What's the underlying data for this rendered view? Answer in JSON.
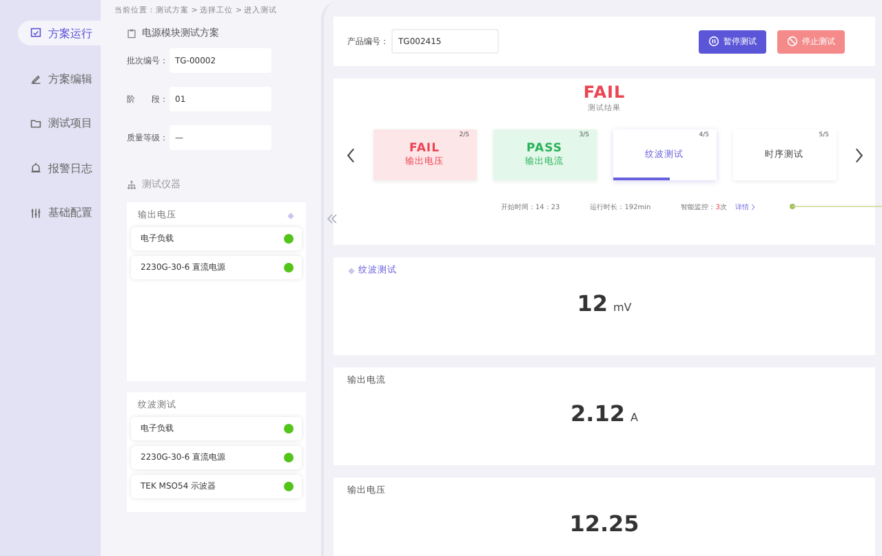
{
  "sidebar": {
    "items": [
      {
        "label": "方案运行",
        "selected": true
      },
      {
        "label": "方案编辑",
        "selected": false
      },
      {
        "label": "测试项目",
        "selected": false
      },
      {
        "label": "报警日志",
        "selected": false
      },
      {
        "label": "基础配置",
        "selected": false
      }
    ]
  },
  "breadcrumb": "当前位置：测试方案 > 选择工位 > 进入测试",
  "plan": {
    "title": "电源模块测试方案",
    "fields": [
      {
        "label": "批次编号：",
        "value": "TG-00002"
      },
      {
        "label": "阶　　段：",
        "value": "01"
      },
      {
        "label": "质量等级：",
        "value": "—"
      }
    ]
  },
  "instruments": {
    "title": "测试仪器",
    "groups": [
      {
        "title": "输出电压",
        "items": [
          {
            "name": "电子负载",
            "color": "#52c41a"
          },
          {
            "name": "2230G-30-6 直流电源",
            "color": "#52c41a"
          }
        ]
      },
      {
        "title": "纹波测试",
        "items": [
          {
            "name": "电子负载",
            "color": "#52c41a"
          },
          {
            "name": "2230G-30-6 直流电源",
            "color": "#52c41a"
          },
          {
            "name": "TEK MSO54 示波器",
            "color": "#52c41a"
          }
        ]
      }
    ]
  },
  "product": {
    "label": "产品编号：",
    "value": "TG002415"
  },
  "buttons": [
    {
      "label": "暂停测试",
      "kind": "pause"
    },
    {
      "label": "停止测试",
      "kind": "stop"
    }
  ],
  "result": {
    "verdict": "FAIL",
    "caption": "测试结果"
  },
  "steps": [
    {
      "index": "2/5",
      "kind": "fail",
      "verdict": "FAIL",
      "name": "输出电压"
    },
    {
      "index": "3/5",
      "kind": "pass",
      "verdict": "PASS",
      "name": "输出电流"
    },
    {
      "index": "4/5",
      "kind": "active",
      "name": "纹波测试",
      "level": 0.55
    },
    {
      "index": "5/5",
      "kind": "pending",
      "name": "时序测试"
    }
  ],
  "status": {
    "start": "开始时间：14：23",
    "duration": "运行时长：192min",
    "monitor_label": "智能监控：",
    "monitor_count": "3",
    "monitor_unit": "次",
    "details": "详情"
  },
  "measurements": [
    {
      "title": "纹波测试",
      "value": "12",
      "unit": "mV",
      "highlight": true
    },
    {
      "title": "输出电流",
      "value": "2.12",
      "unit": "A",
      "highlight": false
    },
    {
      "title": "输出电压",
      "value": "12.25",
      "highlight": false
    }
  ]
}
